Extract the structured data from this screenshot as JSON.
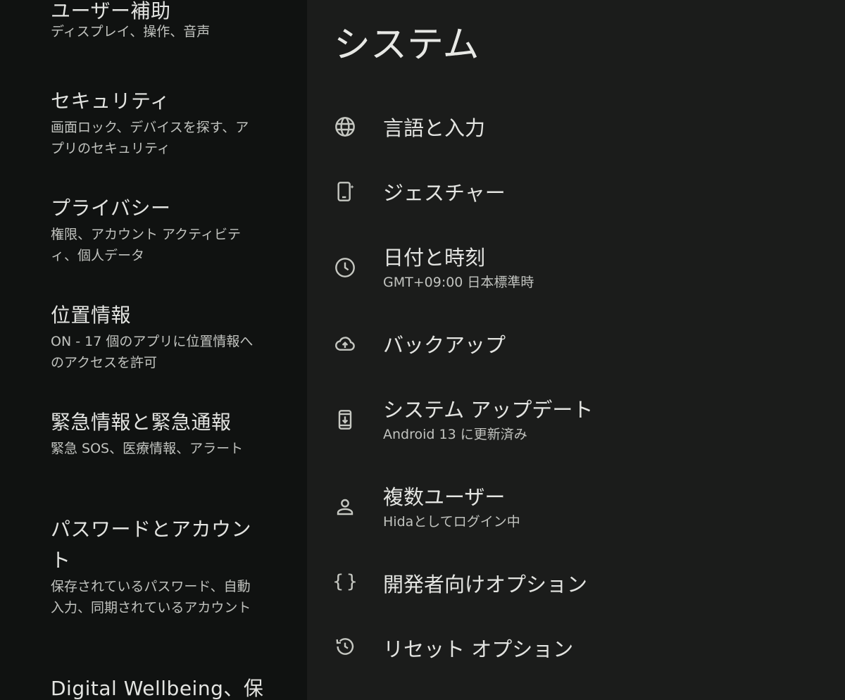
{
  "sidebar": {
    "items": [
      {
        "title": "ユーザー補助",
        "subtitle": "ディスプレイ、操作、音声"
      },
      {
        "title": "セキュリティ",
        "subtitle": "画面ロック、デバイスを探す、アプリのセキュリティ"
      },
      {
        "title": "プライバシー",
        "subtitle": "権限、アカウント アクティビティ、個人データ"
      },
      {
        "title": "位置情報",
        "subtitle": "ON - 17 個のアプリに位置情報へのアクセスを許可"
      },
      {
        "title": "緊急情報と緊急通報",
        "subtitle": "緊急 SOS、医療情報、アラート"
      },
      {
        "title": "パスワードとアカウント",
        "subtitle": "保存されているパスワード、自動入力、同期されているアカウント"
      },
      {
        "title": "Digital Wellbeing、保",
        "subtitle": ""
      }
    ]
  },
  "main": {
    "title": "システム",
    "items": [
      {
        "title": "言語と入力",
        "subtitle": "",
        "icon": "globe-icon"
      },
      {
        "title": "ジェスチャー",
        "subtitle": "",
        "icon": "gesture-phone-icon"
      },
      {
        "title": "日付と時刻",
        "subtitle": "GMT+09:00 日本標準時",
        "icon": "clock-icon"
      },
      {
        "title": "バックアップ",
        "subtitle": "",
        "icon": "cloud-upload-icon"
      },
      {
        "title": "システム アップデート",
        "subtitle": "Android 13 に更新済み",
        "icon": "system-update-icon"
      },
      {
        "title": "複数ユーザー",
        "subtitle": "Hidaとしてログイン中",
        "icon": "person-icon"
      },
      {
        "title": "開発者向けオプション",
        "subtitle": "",
        "icon": "braces-icon"
      },
      {
        "title": "リセット オプション",
        "subtitle": "",
        "icon": "history-icon"
      }
    ]
  },
  "colors": {
    "sidebar_bg": "#101211",
    "main_bg": "#1b1c1b",
    "primary_text": "#e3e4e1",
    "secondary_text": "#c1c3bf"
  }
}
